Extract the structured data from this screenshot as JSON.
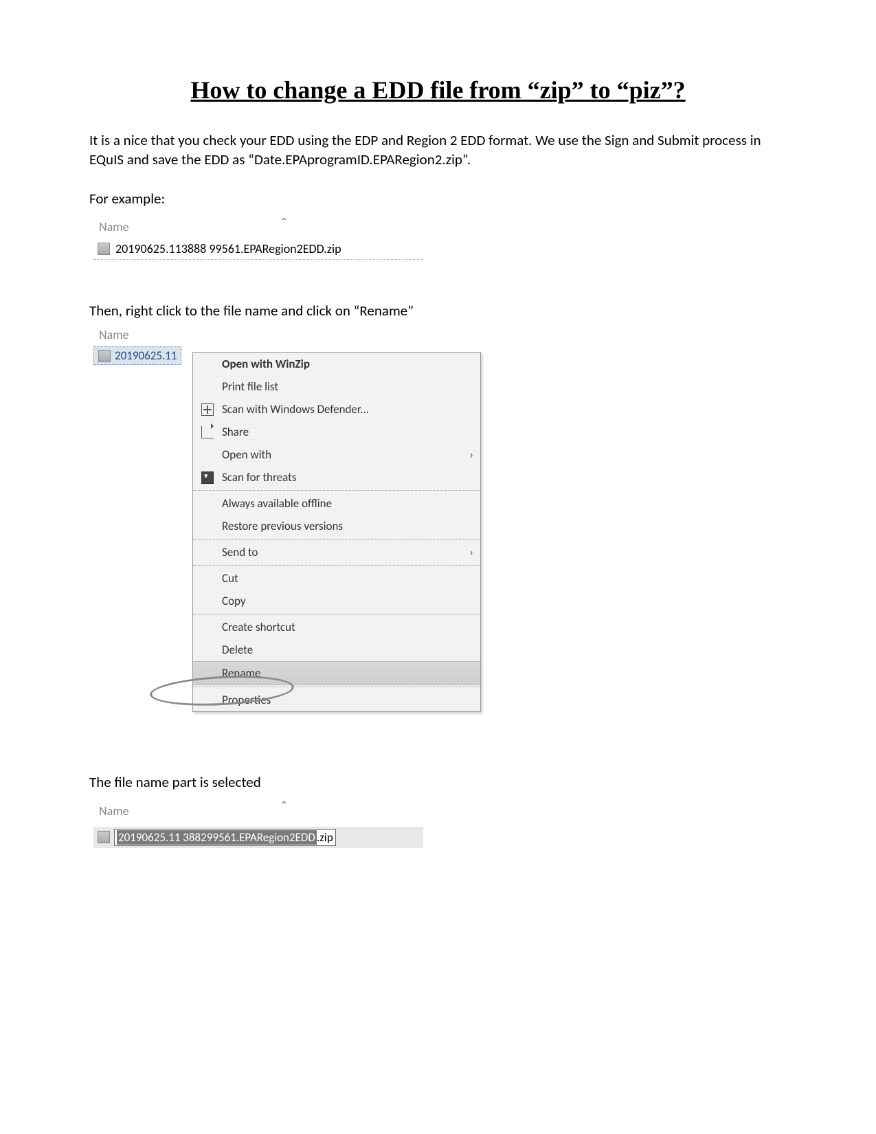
{
  "title": "How to change a EDD file from “zip” to “piz”?",
  "intro": "It is a nice that you check your EDD using the EDP and Region 2 EDD format.  We use the Sign and Submit process in EQuIS and save the EDD as “Date.EPAprogramID.EPARegion2.zip”.",
  "for_example": "For example:",
  "name_label": "Name",
  "file1": "20190625.113888 99561.EPARegion2EDD.zip",
  "then_text": "Then, right click to the file name and click on “Rename”",
  "sel_file_truncated": "20190625.11",
  "context_menu": {
    "open_winzip": "Open with WinZip",
    "print_list": "Print file list",
    "scan_defender": "Scan with Windows Defender...",
    "share": "Share",
    "open_with": "Open with",
    "scan_threats": "Scan for threats",
    "always_offline": "Always available offline",
    "restore_prev": "Restore previous versions",
    "send_to": "Send to",
    "cut": "Cut",
    "copy": "Copy",
    "create_shortcut": "Create shortcut",
    "delete": "Delete",
    "rename": "Rename",
    "properties": "Properties"
  },
  "selected_text": "The file name part is selected",
  "rename": {
    "selected_part": "20190625.11 388299561.EPARegion2EDD",
    "ext": ".zip"
  }
}
